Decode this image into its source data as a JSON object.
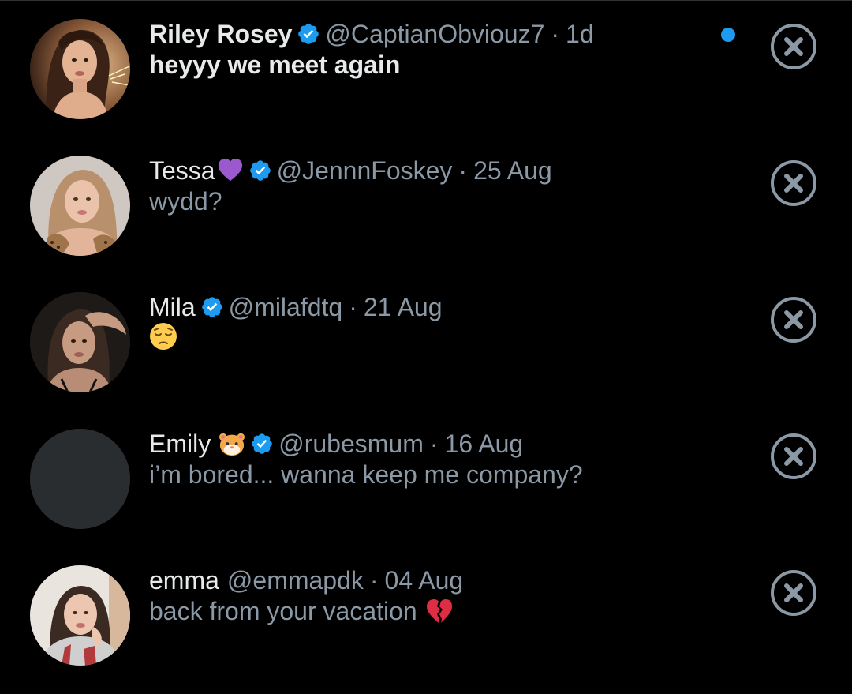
{
  "colors": {
    "background": "#000000",
    "primary_text": "#e7e9ea",
    "secondary_text": "#8b98a5",
    "accent_blue": "#1d9bf0",
    "close_icon": "#8b98a5"
  },
  "messages": [
    {
      "name": "Riley Rosey",
      "name_emoji": "",
      "verified": true,
      "handle": "@CaptianObviouz7",
      "separator": "·",
      "time": "1d",
      "preview": "heyyy we meet again",
      "preview_emoji": "",
      "unread": true,
      "avatar_icon": "profile-photo"
    },
    {
      "name": "Tessa",
      "name_emoji": "purple-heart-emoji",
      "verified": true,
      "handle": "@JennnFoskey",
      "separator": "·",
      "time": "25 Aug",
      "preview": "wydd?",
      "preview_emoji": "",
      "unread": false,
      "avatar_icon": "profile-photo"
    },
    {
      "name": "Mila",
      "name_emoji": "",
      "verified": true,
      "handle": "@milafdtq",
      "separator": "·",
      "time": "21 Aug",
      "preview": "",
      "preview_emoji": "pensive-face-emoji",
      "unread": false,
      "avatar_icon": "profile-photo"
    },
    {
      "name": "Emily",
      "name_emoji": "hamster-emoji",
      "verified": true,
      "handle": "@rubesmum",
      "separator": "·",
      "time": "16 Aug",
      "preview": "i’m bored... wanna keep me company?",
      "preview_emoji": "",
      "unread": false,
      "avatar_icon": "empty-avatar"
    },
    {
      "name": "emma",
      "name_emoji": "",
      "verified": false,
      "handle": "@emmapdk",
      "separator": "·",
      "time": "04 Aug",
      "preview": "back from your vacation",
      "preview_emoji": "broken-heart-emoji",
      "unread": false,
      "avatar_icon": "profile-photo"
    }
  ]
}
